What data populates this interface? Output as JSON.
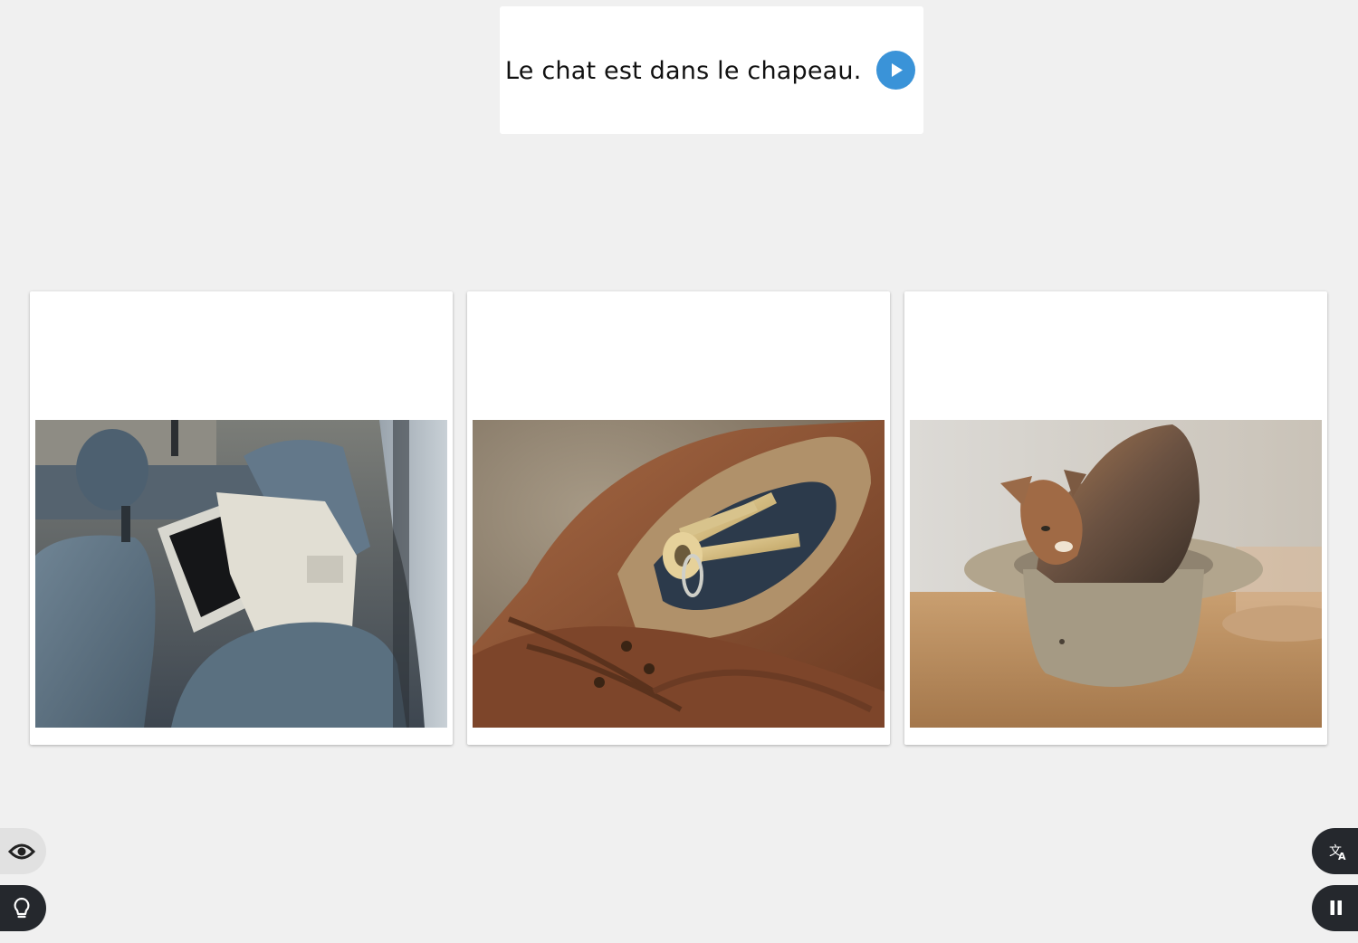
{
  "prompt": {
    "sentence": "Le chat est dans le chapeau."
  },
  "choices": [
    {
      "image": "computer-in-car-backseat-photo"
    },
    {
      "image": "keys-in-shoe-photo"
    },
    {
      "image": "cat-in-hat-photo"
    }
  ],
  "controls": {
    "play_icon": "play-icon",
    "eye_icon": "eye-icon",
    "hint_icon": "lightbulb-icon",
    "translate_icon": "translate-icon",
    "pause_icon": "pause-icon"
  },
  "colors": {
    "background": "#f0f0f0",
    "card": "#ffffff",
    "play_accent": "#3a93d8",
    "dark_button": "#25282d",
    "light_button": "#e1e1e1"
  }
}
